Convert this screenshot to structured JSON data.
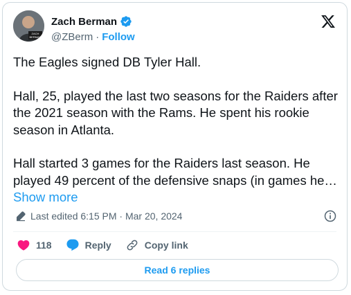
{
  "author": {
    "name": "Zach Berman",
    "handle": "@ZBerm",
    "separator": "·",
    "follow_label": "Follow",
    "avatar_badge": "ZACH BERMAN"
  },
  "tweet": {
    "paragraphs": [
      "The Eagles signed DB Tyler Hall.",
      "Hall, 25, played the last two seasons for the Raiders after the 2021 season with the Rams. He spent his rookie season in Atlanta.",
      "Hall started 3 games for the Raiders last season. He played 49 percent of the defensive snaps (in games he…"
    ],
    "show_more_label": "Show more",
    "edited_label": "Last edited 6:15 PM · Mar 20, 2024"
  },
  "actions": {
    "likes_count": "118",
    "reply_label": "Reply",
    "copy_link_label": "Copy link",
    "read_replies_label": "Read 6 replies"
  },
  "colors": {
    "accent": "#1d9bf0",
    "like": "#f91880",
    "muted": "#536471",
    "border": "#cfd9de"
  },
  "icons": [
    "verified-badge-icon",
    "x-logo-icon",
    "pencil-icon",
    "info-icon",
    "heart-icon",
    "reply-bubble-icon",
    "link-icon"
  ]
}
